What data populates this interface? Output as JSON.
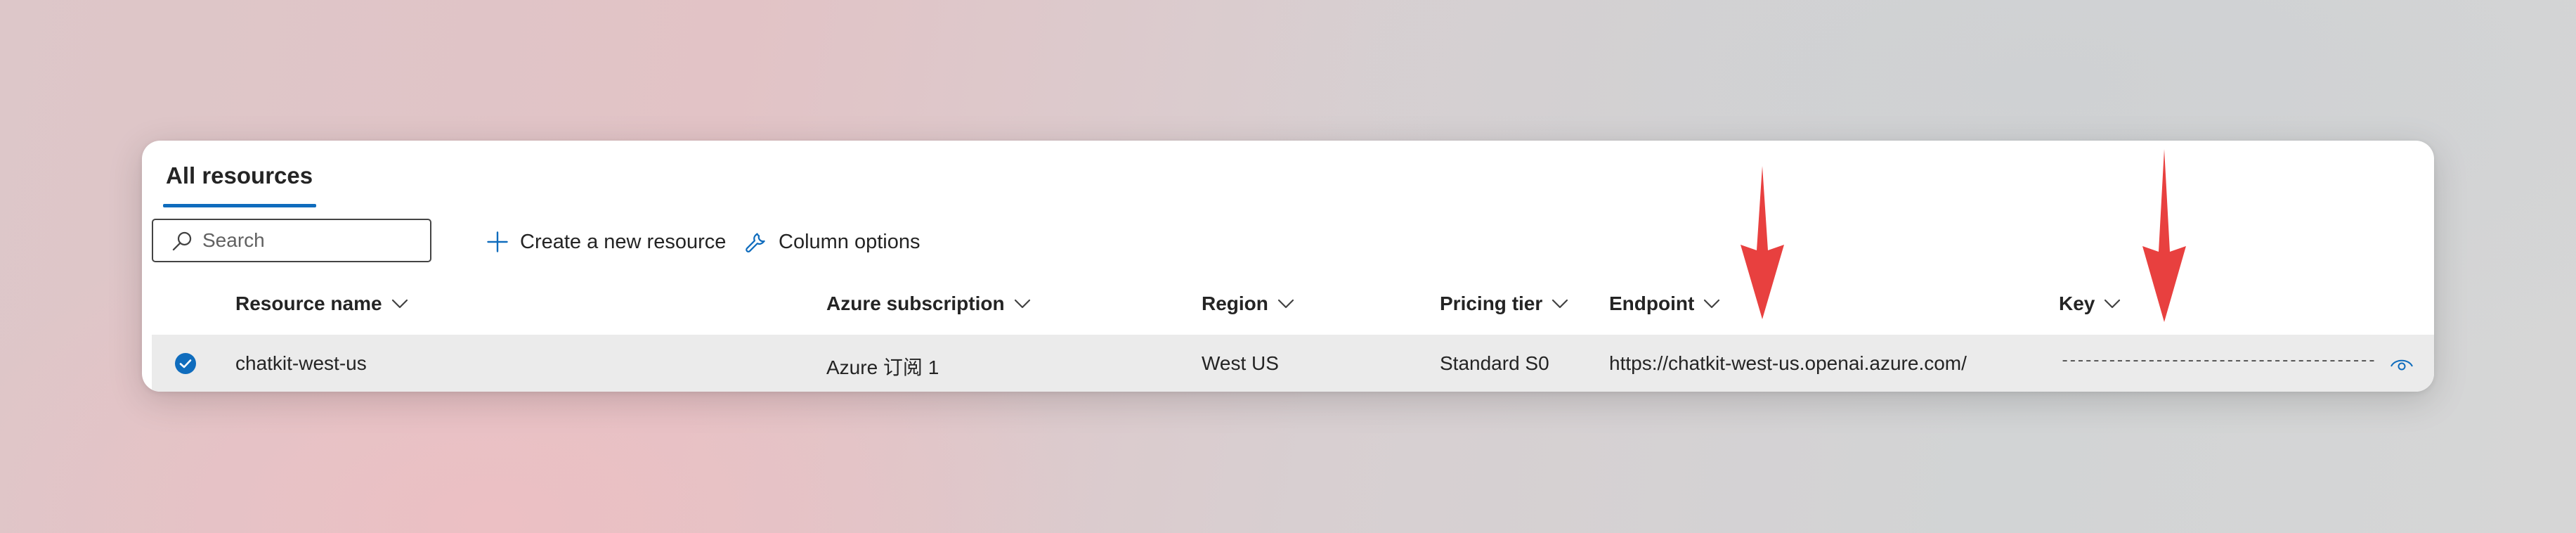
{
  "panel": {
    "title": "All resources",
    "search": {
      "placeholder": "Search",
      "value": ""
    },
    "toolbar": {
      "create_label": "Create a new resource",
      "column_options_label": "Column options"
    },
    "columns": [
      {
        "key": "name",
        "label": "Resource name"
      },
      {
        "key": "subscription",
        "label": "Azure subscription"
      },
      {
        "key": "region",
        "label": "Region"
      },
      {
        "key": "tier",
        "label": "Pricing tier"
      },
      {
        "key": "endpoint",
        "label": "Endpoint"
      },
      {
        "key": "key",
        "label": "Key"
      }
    ],
    "rows": [
      {
        "selected": true,
        "name": "chatkit-west-us",
        "subscription": "Azure 订阅 1",
        "region": "West US",
        "tier": "Standard S0",
        "endpoint": "https://chatkit-west-us.openai.azure.com/",
        "key": "----------------------------------------"
      }
    ]
  },
  "colors": {
    "accent": "#0f6cbd",
    "annotation_arrow": "#e8403f",
    "selected_row": "#ebebeb"
  },
  "icons": [
    "search-icon",
    "plus-icon",
    "wrench-icon",
    "chevron-down-icon",
    "checkmark-circle-icon",
    "eye-icon",
    "arrow-down-icon"
  ]
}
